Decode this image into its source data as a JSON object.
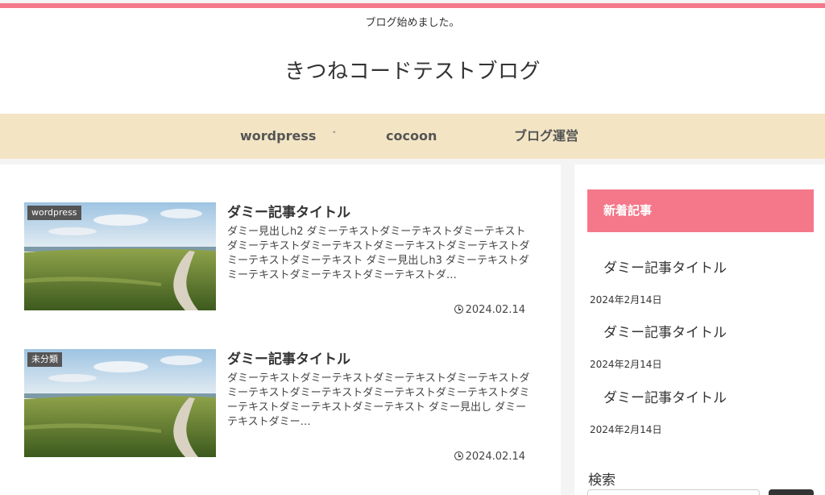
{
  "header": {
    "tagline": "ブログ始めました。",
    "site_title": "きつねコードテストブログ"
  },
  "nav": {
    "items": [
      {
        "label": "wordpress",
        "has_dropdown": true
      },
      {
        "label": "cocoon"
      },
      {
        "label": "ブログ運営"
      }
    ],
    "dropdown_glyph": "˅"
  },
  "posts": [
    {
      "category": "wordpress",
      "title": "ダミー記事タイトル",
      "excerpt": "ダミー見出しh2 ダミーテキストダミーテキストダミーテキストダミーテキストダミーテキストダミーテキストダミーテキストダミーテキストダミーテキスト ダミー見出しh3 ダミーテキストダミーテキストダミーテキストダミーテキストダ…",
      "date": "2024.02.14"
    },
    {
      "category": "未分類",
      "title": "ダミー記事タイトル",
      "excerpt": "ダミーテキストダミーテキストダミーテキストダミーテキストダミーテキストダミーテキストダミーテキストダミーテキストダミーテキストダミーテキストダミーテキスト ダミー見出し ダミーテキストダミー…",
      "date": "2024.02.14"
    }
  ],
  "sidebar": {
    "recent_heading": "新着記事",
    "recent": [
      {
        "title": "ダミー記事タイトル",
        "date": "2024年2月14日"
      },
      {
        "title": "ダミー記事タイトル",
        "date": "2024年2月14日"
      },
      {
        "title": "ダミー記事タイトル",
        "date": "2024年2月14日"
      }
    ],
    "search_heading": "検索",
    "search_value": ""
  },
  "colors": {
    "accent": "#f4788a",
    "nav_bg": "#f3e5c4",
    "page_bg": "#f4f4f4",
    "category_label_bg": "#555555",
    "search_button": "#333333"
  },
  "icons": {
    "date": "clock-icon",
    "nav_dropdown": "chevron-down-icon"
  }
}
